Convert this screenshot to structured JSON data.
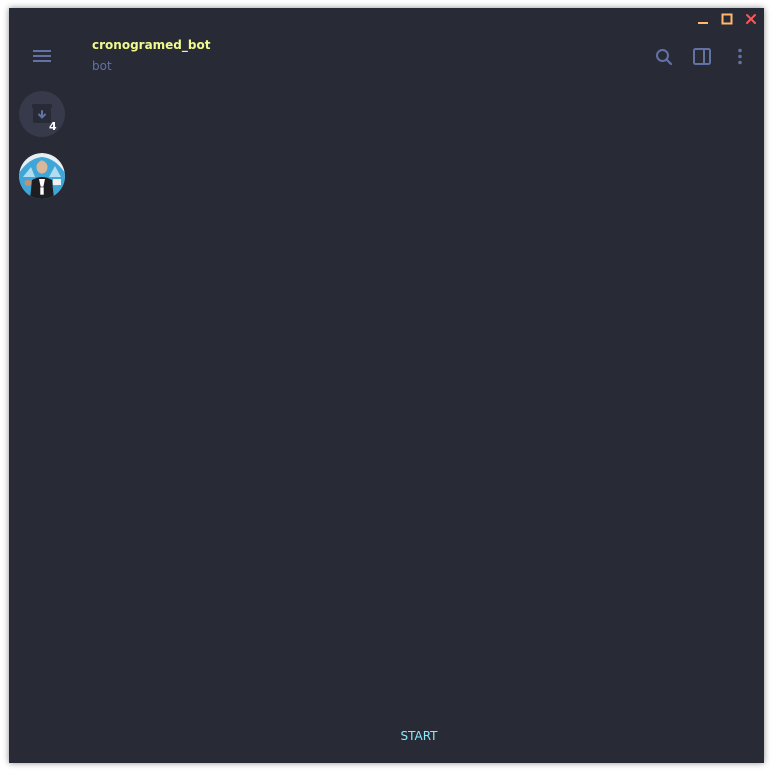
{
  "window": {
    "controls": {
      "minimize_icon": "minimize-icon",
      "maximize_icon": "maximize-icon",
      "close_icon": "close-icon"
    }
  },
  "sidebar": {
    "menu_icon": "hamburger-menu-icon",
    "archive": {
      "icon": "archive-icon",
      "badge": "4"
    },
    "chat_avatar": "avatar-image"
  },
  "header": {
    "title": "cronogramed_bot",
    "subtitle": "bot",
    "actions": [
      "search-icon",
      "sidebar-toggle-icon",
      "more-vertical-icon"
    ]
  },
  "footer": {
    "start_label": "START"
  },
  "colors": {
    "background": "#282a35",
    "title": "#f1fa8c",
    "subtitle": "#6272a4",
    "icons": "#6272a4",
    "start": "#8be9fd",
    "minimize": "#ffb86c",
    "maximize": "#ffb86c",
    "close": "#ff5555"
  }
}
